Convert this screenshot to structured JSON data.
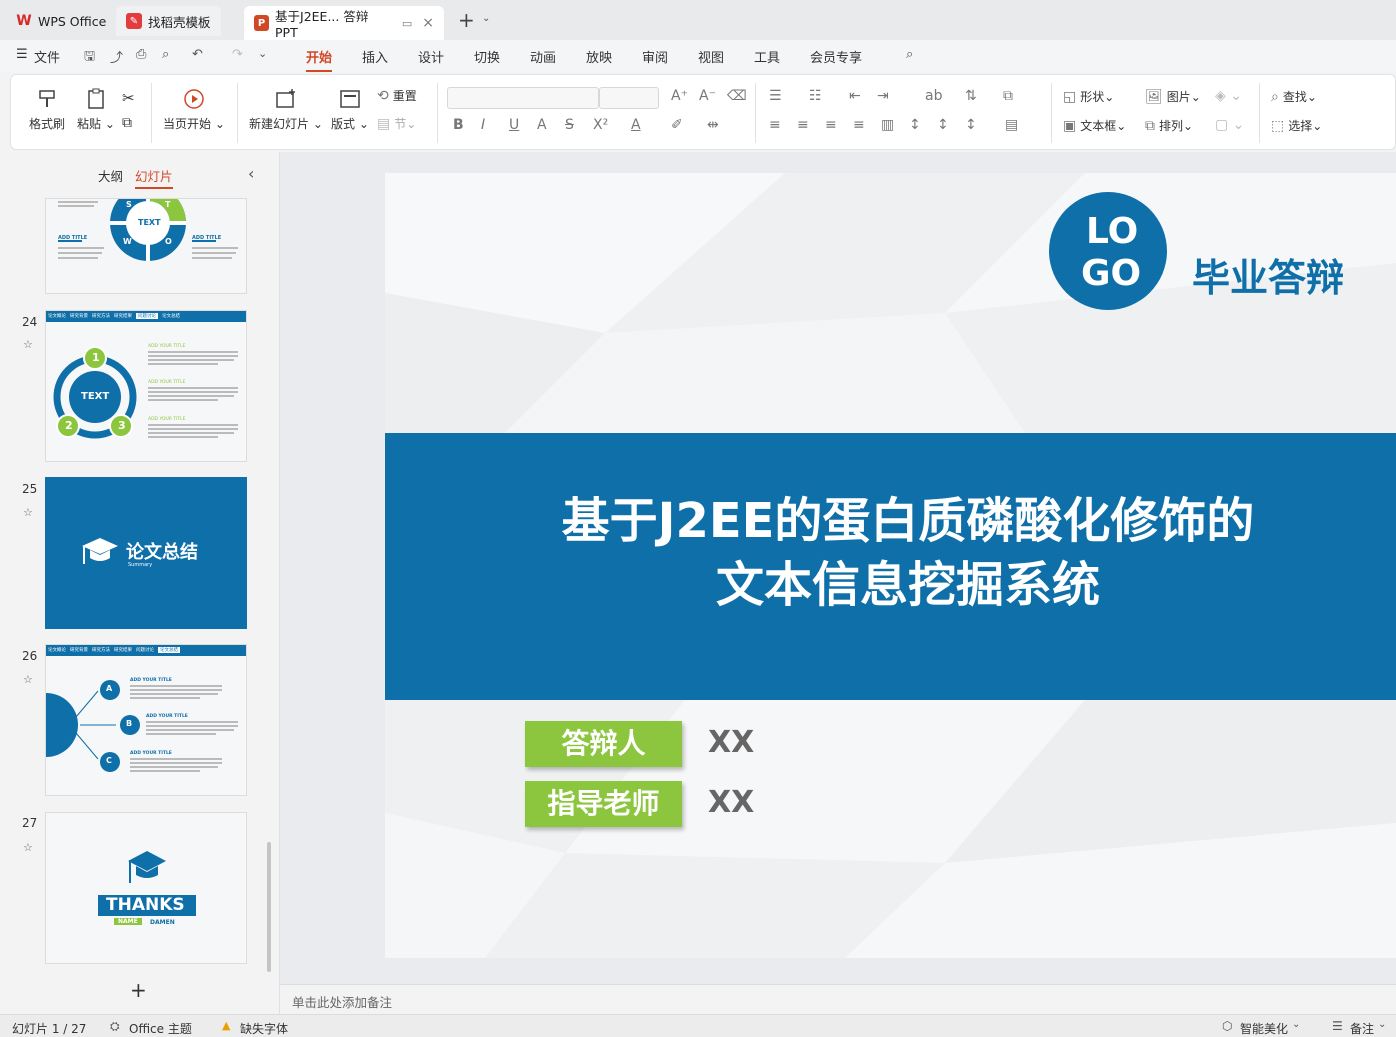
{
  "tabs": [
    {
      "label": "WPS Office"
    },
    {
      "label": "找稻壳模板"
    },
    {
      "label": "基于J2EE... 答辩PPT"
    }
  ],
  "menu": {
    "file_label": "文件",
    "items": [
      "开始",
      "插入",
      "设计",
      "切换",
      "动画",
      "放映",
      "审阅",
      "视图",
      "工具",
      "会员专享"
    ]
  },
  "ribbon": {
    "format_painter": "格式刷",
    "paste": "粘贴",
    "start_current": "当页开始",
    "new_slide": "新建幻灯片",
    "layout": "版式",
    "reset": "重置",
    "section": "节",
    "shape": "形状",
    "picture": "图片",
    "find": "查找",
    "textbox": "文本框",
    "arrange": "排列",
    "select": "选择"
  },
  "panel": {
    "outline_tab": "大纲",
    "slides_tab": "幻灯片",
    "add_symbol": "+"
  },
  "thumbs": [
    {
      "num": "24",
      "title1": "TEXT",
      "n1": "1",
      "n2": "2",
      "n3": "3",
      "h": "ADD YOUR TITLE"
    },
    {
      "num": "25",
      "title": "论文总结",
      "sub": "Summary"
    },
    {
      "num": "26",
      "a": "A",
      "b": "B",
      "c": "C",
      "h": "ADD YOUR TITLE"
    },
    {
      "num": "27",
      "thanks": "THANKS",
      "name": "NAME",
      "damen": "DAMEN"
    }
  ],
  "thumb_top": {
    "text": "TEXT",
    "s": "S",
    "t": "T",
    "w": "W",
    "o": "O",
    "add_title": "ADD  TITLE"
  },
  "nav_tabs": [
    "论文概论",
    "研究背景",
    "研究方法",
    "研究结果",
    "问题讨论",
    "论文总结"
  ],
  "slide": {
    "logo_line1": "LO",
    "logo_line2": "GO",
    "defense_label": "毕业答辩",
    "title_line1": "基于J2EE的蛋白质磷酸化修饰的",
    "title_line2": "文本信息挖掘系统",
    "presenter_label": "答辩人",
    "presenter_value": "XX",
    "advisor_label": "指导老师",
    "advisor_value": "XX"
  },
  "notes_placeholder": "单击此处添加备注",
  "status": {
    "slide_counter": "幻灯片 1 / 27",
    "theme": "Office 主题",
    "missing_font": "缺失字体",
    "smart_beautify": "智能美化",
    "notes": "备注"
  },
  "colors": {
    "accent": "#d24726",
    "slide_blue": "#0f6fa8",
    "slide_green": "#8cc63f"
  }
}
